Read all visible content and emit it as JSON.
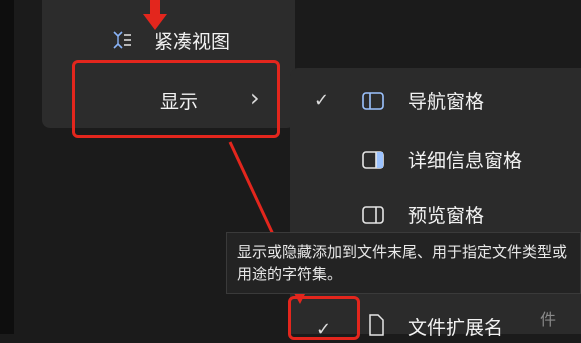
{
  "menu": {
    "compact_view_label": "紧凑视图",
    "show_label": "显示",
    "show_chevron": "›"
  },
  "submenu": {
    "items": [
      {
        "label": "导航窗格",
        "checked": true,
        "icon": "navigation-pane-icon"
      },
      {
        "label": "详细信息窗格",
        "checked": false,
        "icon": "details-pane-icon"
      },
      {
        "label": "预览窗格",
        "checked": false,
        "icon": "preview-pane-icon"
      },
      {
        "label": "文件扩展名",
        "checked": true,
        "icon": "file-icon"
      }
    ],
    "check_glyph": "✓"
  },
  "tooltip": {
    "text": "显示或隐藏添加到文件末尾、用于指定文件类型或用途的字符集。"
  },
  "background_fragment": "件",
  "colors": {
    "annotation_red": "#e3261d",
    "menu_bg": "#2c2c2c"
  }
}
